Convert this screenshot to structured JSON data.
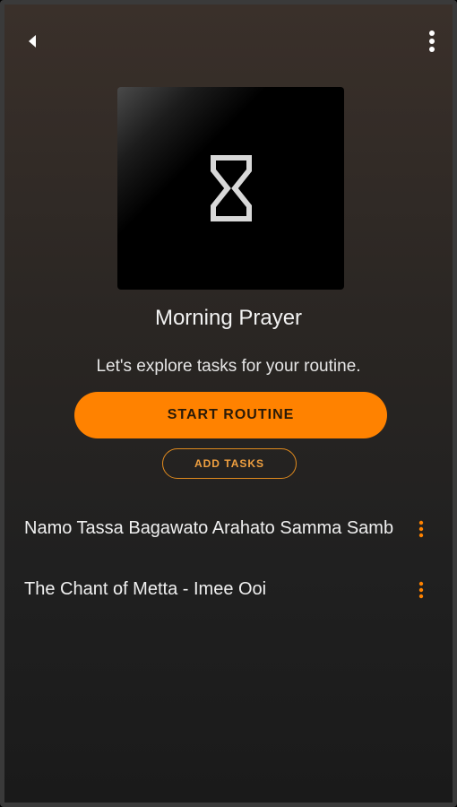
{
  "header": {
    "back_icon": "back-arrow-icon",
    "more_icon": "more-vertical-icon"
  },
  "routine": {
    "cover_icon": "hourglass-icon",
    "title": "Morning Prayer",
    "subtitle": "Let's explore tasks for your routine.",
    "start_label": "START ROUTINE",
    "add_tasks_label": "ADD TASKS"
  },
  "tasks": [
    {
      "label": "Namo Tassa Bagawato Arahato Samma Sambuddhassa",
      "menu_icon": "more-vertical-icon"
    },
    {
      "label": "The Chant of Metta - Imee Ooi",
      "menu_icon": "more-vertical-icon"
    }
  ],
  "colors": {
    "accent": "#ff8200",
    "accent_outline": "#e08a1e",
    "background_top": "#3a302a",
    "background_bottom": "#1a1a1a"
  }
}
